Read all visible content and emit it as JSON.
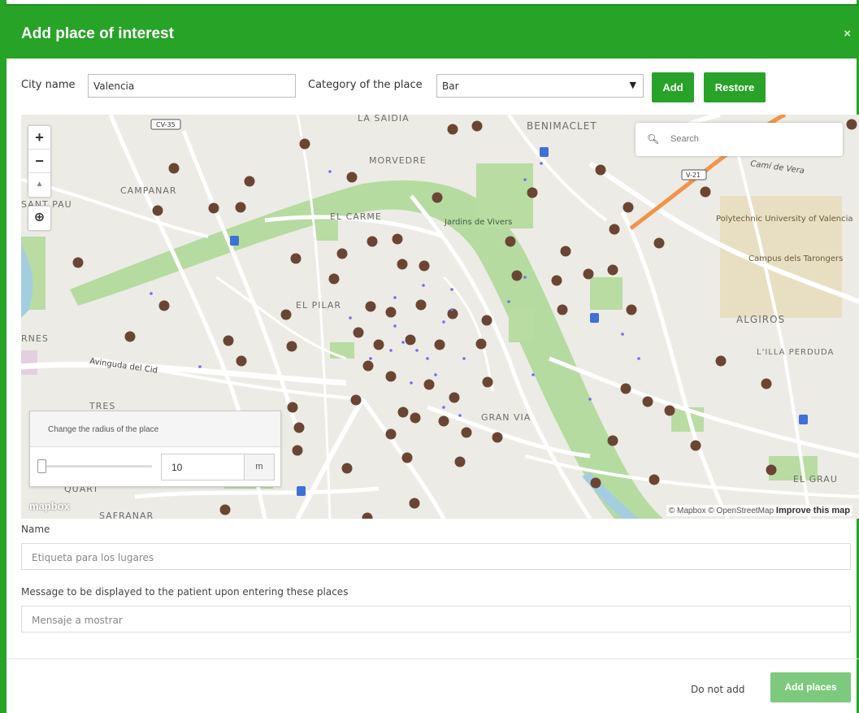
{
  "dialog": {
    "title": "Add place of interest",
    "close_symbol": "×"
  },
  "form": {
    "city_label": "City name",
    "city_value": "Valencia",
    "category_label": "Category of the place",
    "category_value": "Bar",
    "category_arrow": "▼",
    "add_button": "Add",
    "restore_button": "Restore"
  },
  "map": {
    "zoom_in": "+",
    "zoom_out": "−",
    "compass": "▲",
    "search_placeholder": "Search",
    "search_icon": "magnifier-icon",
    "labels": {
      "la_saidia": "LA SAIDIA",
      "benimaclet": "BENIMACLET",
      "morvedre": "MORVEDRE",
      "campanar": "CAMPANAR",
      "sant_pau": "SANT PAU",
      "el_carme": "EL CARME",
      "jardins": "Jardins de Vivers",
      "polytechnic": "Polytechnic University of Valencia",
      "campus": "Campus dels Tarongers",
      "el_pilar": "EL PILAR",
      "algiros": "ALGIROS",
      "lilla": "L'ILLA PERDUDA",
      "avinguda": "Avinguda del Cid",
      "tres": "TRES",
      "gran_via": "GRAN VIA",
      "el_grau": "EL GRAU",
      "quart": "QUART",
      "safranar": "SAFRANAR",
      "nes": "RNES",
      "cami": "Camí de Vera",
      "road_cv35": "CV-35",
      "road_v21": "V-21"
    },
    "attribution": "© Mapbox © OpenStreetMap",
    "improve": "Improve this map",
    "logo": "mapbox",
    "marker_color": "#6b4534"
  },
  "radius": {
    "title": "Change the radius of the place",
    "value": "10",
    "unit": "m",
    "slider_fraction": 0.0
  },
  "fields": {
    "name_label": "Name",
    "name_placeholder": "Etiqueta para los lugares",
    "message_label": "Message to be displayed to the patient upon entering these places",
    "message_placeholder": "Mensaje a mostrar"
  },
  "footer": {
    "cancel": "Do not add",
    "submit": "Add places"
  }
}
